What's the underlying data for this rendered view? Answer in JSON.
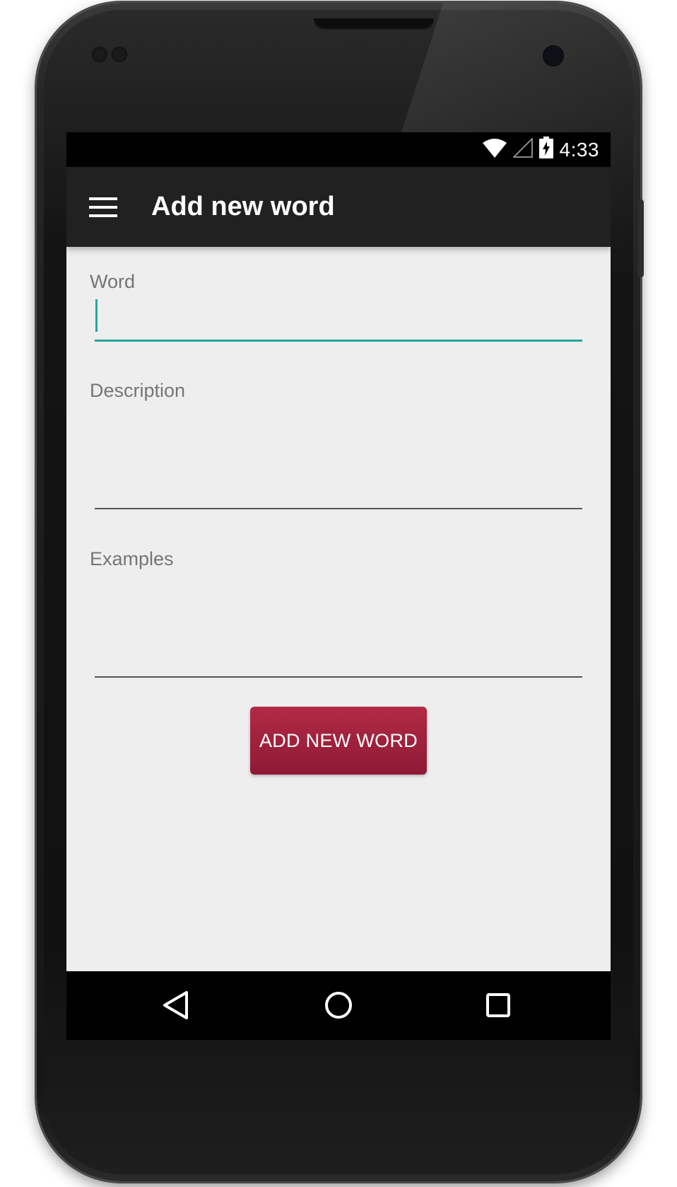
{
  "status_bar": {
    "time": "4:33",
    "icons": [
      "wifi-icon",
      "cell-signal-icon",
      "battery-charging-icon"
    ]
  },
  "app_bar": {
    "title": "Add new word",
    "menu_icon": "hamburger-menu-icon"
  },
  "form": {
    "word": {
      "label": "Word",
      "value": ""
    },
    "description": {
      "label": "Description",
      "value": ""
    },
    "examples": {
      "label": "Examples",
      "value": ""
    },
    "submit_label": "ADD NEW WORD"
  },
  "nav_bar": {
    "icons": [
      "back-icon",
      "home-icon",
      "recents-icon"
    ]
  },
  "colors": {
    "accent": "#26a69a",
    "app_bar": "#212121",
    "button": "#a3223f",
    "background": "#eeeeee"
  }
}
